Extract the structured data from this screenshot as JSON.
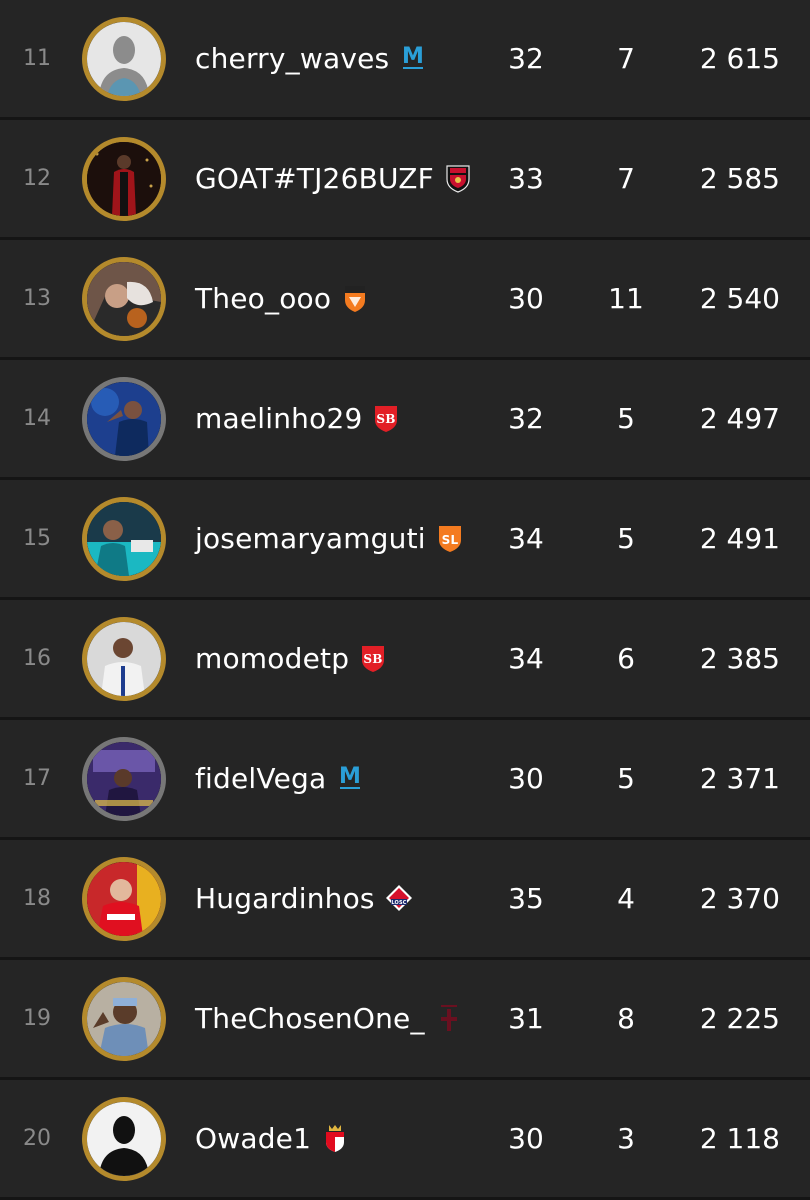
{
  "leaderboard": [
    {
      "rank": "11",
      "name": "cherry_waves",
      "matches": "32",
      "wins": "7",
      "points": "2 615",
      "club_icon": "marseille-crest-icon",
      "avatar": "silhouette",
      "avatar_ring": "gold"
    },
    {
      "rank": "12",
      "name": "GOAT#TJ26BUZF",
      "matches": "33",
      "wins": "7",
      "points": "2 585",
      "club_icon": "nice-crest-icon",
      "avatar": "photo",
      "avatar_ring": "gold"
    },
    {
      "rank": "13",
      "name": "Theo_ooo",
      "matches": "30",
      "wins": "11",
      "points": "2 540",
      "club_icon": "lorient-crest-icon",
      "avatar": "photo",
      "avatar_ring": "gold"
    },
    {
      "rank": "14",
      "name": "maelinho29",
      "matches": "32",
      "wins": "5",
      "points": "2 497",
      "club_icon": "brest-crest-icon",
      "avatar": "photo",
      "avatar_ring": "silver"
    },
    {
      "rank": "15",
      "name": "josemaryamguti",
      "matches": "34",
      "wins": "5",
      "points": "2 491",
      "club_icon": "lorient-stade-crest-icon",
      "avatar": "photo",
      "avatar_ring": "gold"
    },
    {
      "rank": "16",
      "name": "momodetp",
      "matches": "34",
      "wins": "6",
      "points": "2 385",
      "club_icon": "brest-crest-icon",
      "avatar": "photo",
      "avatar_ring": "gold"
    },
    {
      "rank": "17",
      "name": "fidelVega",
      "matches": "30",
      "wins": "5",
      "points": "2 371",
      "club_icon": "marseille-crest-icon",
      "avatar": "photo",
      "avatar_ring": "silver"
    },
    {
      "rank": "18",
      "name": "Hugardinhos",
      "matches": "35",
      "wins": "4",
      "points": "2 370",
      "club_icon": "lille-crest-icon",
      "avatar": "photo",
      "avatar_ring": "gold"
    },
    {
      "rank": "19",
      "name": "TheChosenOne_",
      "matches": "31",
      "wins": "8",
      "points": "2 225",
      "club_icon": "toulouse-cross-icon",
      "avatar": "photo",
      "avatar_ring": "gold"
    },
    {
      "rank": "20",
      "name": "Owade1",
      "matches": "30",
      "wins": "3",
      "points": "2 118",
      "club_icon": "monaco-crest-icon",
      "avatar": "silhouette",
      "avatar_ring": "gold"
    }
  ],
  "colors": {
    "background": "#151515",
    "row": "#252525",
    "rank_text": "#8a8a8a",
    "gold_ring": "#b48a2c",
    "silver_ring": "#777777",
    "marseille": "#2a9fd8",
    "brest": "#e21f26",
    "lorient": "#f47b20",
    "lille": "#d6102c",
    "nice": "#c8102e",
    "monaco": "#e10b1e"
  }
}
